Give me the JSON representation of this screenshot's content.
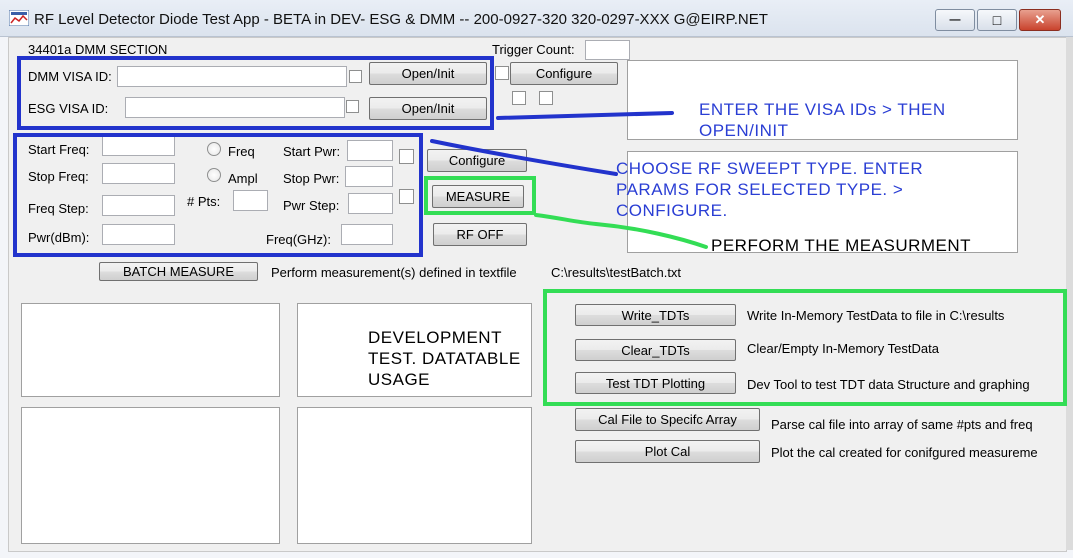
{
  "window": {
    "title": "RF Level Detector Diode Test App - BETA in DEV- ESG & DMM -- 200-0927-320 320-0297-XXX G@EIRP.NET",
    "minimize_glyph": "—",
    "maximize_glyph": "□",
    "close_glyph": "✕"
  },
  "dmm": {
    "section_label": "34401a DMM SECTION",
    "dmm_visa_label": "DMM VISA ID:",
    "dmm_visa_value": "",
    "esg_visa_label": "ESG VISA ID:",
    "esg_visa_value": "",
    "open_init_label": "Open/Init",
    "open_init2_label": "Open/Init"
  },
  "trigger": {
    "label": "Trigger Count:",
    "value": "",
    "configure_label": "Configure"
  },
  "sweep": {
    "start_freq_label": "Start Freq:",
    "stop_freq_label": "Stop Freq:",
    "freq_step_label": "Freq Step:",
    "pwr_dbm_label": "Pwr(dBm):",
    "freq_radio_label": "Freq",
    "ampl_radio_label": "Ampl",
    "npts_label": "# Pts:",
    "start_pwr_label": "Start Pwr:",
    "stop_pwr_label": "Stop Pwr:",
    "pwr_step_label": "Pwr Step:",
    "freq_ghz_label": "Freq(GHz):",
    "configure_label": "Configure",
    "measure_label": "MEASURE",
    "rf_off_label": "RF OFF"
  },
  "batch": {
    "button_label": "BATCH MEASURE",
    "description": "Perform measurement(s) defined in textfile",
    "file_path": "C:\\results\\testBatch.txt"
  },
  "tdt": {
    "write_label": "Write_TDTs",
    "write_desc": "Write In-Memory TestData to  file in C:\\results",
    "clear_label": "Clear_TDTs",
    "clear_desc": "Clear/Empty  In-Memory TestData",
    "plot_label": "Test TDT Plotting",
    "plot_desc": "Dev Tool to test TDT data Structure and graphing"
  },
  "cal": {
    "array_label": "Cal File to Specifc Array",
    "array_desc": "Parse cal file into array of same #pts and freq",
    "plot_label": "Plot Cal",
    "plot_desc": "Plot the cal created for conifgured measureme"
  },
  "annotations": {
    "visa_line1": "ENTER THE VISA IDs > THEN",
    "visa_line2": "OPEN/INIT",
    "sweep_line1": "CHOOSE RF SWEEPT TYPE. ENTER",
    "sweep_line2": "PARAMS FOR SELECTED TYPE. >",
    "sweep_line3": "CONFIGURE.",
    "measure_line": "PERFORM THE MEASURMENT",
    "dev_line1": "DEVELOPMENT",
    "dev_line2": "TEST. DATATABLE",
    "dev_line3": "USAGE"
  },
  "colors": {
    "annotation_blue": "#2233cc",
    "annotation_green": "#33dd55"
  }
}
